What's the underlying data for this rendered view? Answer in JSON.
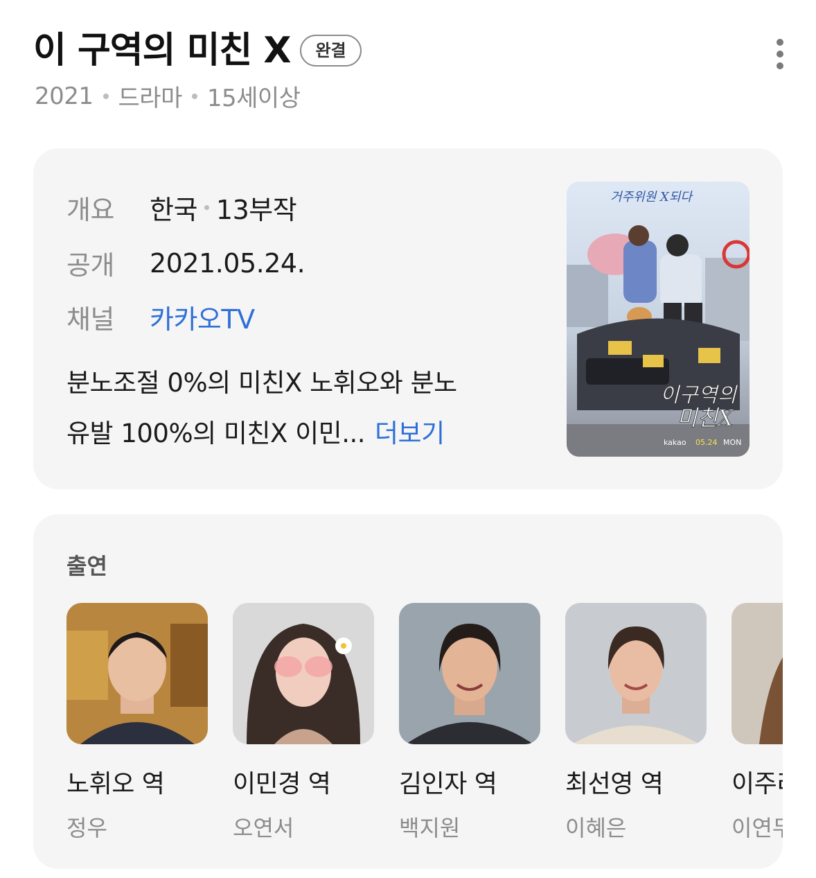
{
  "header": {
    "title": "이 구역의 미친 X",
    "badge": "완결",
    "meta": [
      "2021",
      "드라마",
      "15세이상"
    ]
  },
  "info": {
    "rows": [
      {
        "label": "개요",
        "value_parts": [
          "한국",
          "13부작"
        ]
      },
      {
        "label": "공개",
        "value": "2021.05.24."
      },
      {
        "label": "채널",
        "value": "카카오TV",
        "link": true
      }
    ],
    "description_line1": "분노조절 0%의 미친X 노휘오와 분노",
    "description_line2": "유발 100%의 미친X 이민...",
    "more_label": "더보기"
  },
  "poster": {
    "top_text": "거주위원 X되다",
    "title_text_1": "이구역의",
    "title_text_2": "미친X",
    "footer_brand": "kakao",
    "footer_date": "05.24",
    "footer_day": "MON"
  },
  "cast": {
    "heading": "출연",
    "members": [
      {
        "role": "노휘오 역",
        "actor": "정우"
      },
      {
        "role": "이민경 역",
        "actor": "오연서"
      },
      {
        "role": "김인자 역",
        "actor": "백지원"
      },
      {
        "role": "최선영 역",
        "actor": "이혜은"
      },
      {
        "role": "이주리",
        "actor": "이연두"
      }
    ]
  },
  "colors": {
    "link": "#2e6fd8",
    "card_bg": "#f5f5f5",
    "muted": "#8c8c8c"
  }
}
